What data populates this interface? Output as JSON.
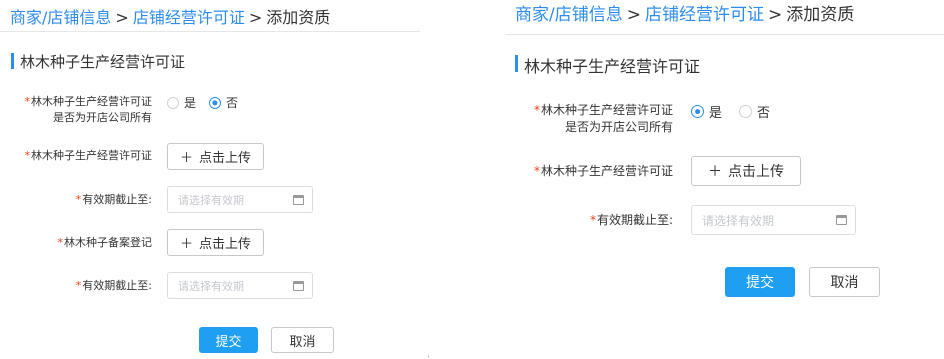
{
  "breadcrumb": {
    "level1": "商家/店铺信息",
    "sep": ">",
    "level2": "店铺经营许可证",
    "current": "添加资质"
  },
  "section_title": "林木种子生产经营许可证",
  "left_form": {
    "ownership_label_line1": "林木种子生产经营许可证",
    "ownership_label_line2": "是否为开店公司所有",
    "ownership_options": [
      {
        "label": "是",
        "checked": false
      },
      {
        "label": "否",
        "checked": true
      }
    ],
    "license_label": "林木种子生产经营许可证",
    "upload_label": "点击上传",
    "validity_label": "有效期截止至:",
    "validity_placeholder": "请选择有效期",
    "filing_label": "林木种子备案登记",
    "filing_upload_label": "点击上传",
    "filing_validity_label": "有效期截止至:",
    "filing_validity_placeholder": "请选择有效期",
    "submit_label": "提交",
    "cancel_label": "取消"
  },
  "right_form": {
    "ownership_label_line1": "林木种子生产经营许可证",
    "ownership_label_line2": "是否为开店公司所有",
    "ownership_options": [
      {
        "label": "是",
        "checked": true
      },
      {
        "label": "否",
        "checked": false
      }
    ],
    "license_label": "林木种子生产经营许可证",
    "upload_label": "点击上传",
    "validity_label": "有效期截止至:",
    "validity_placeholder": "请选择有效期",
    "submit_label": "提交",
    "cancel_label": "取消"
  },
  "colors": {
    "accent": "#2d8cf0",
    "primary_button": "#1e9ff2",
    "required": "#ed4014"
  },
  "icons": {
    "plus": "plus-icon",
    "calendar": "calendar-icon"
  }
}
